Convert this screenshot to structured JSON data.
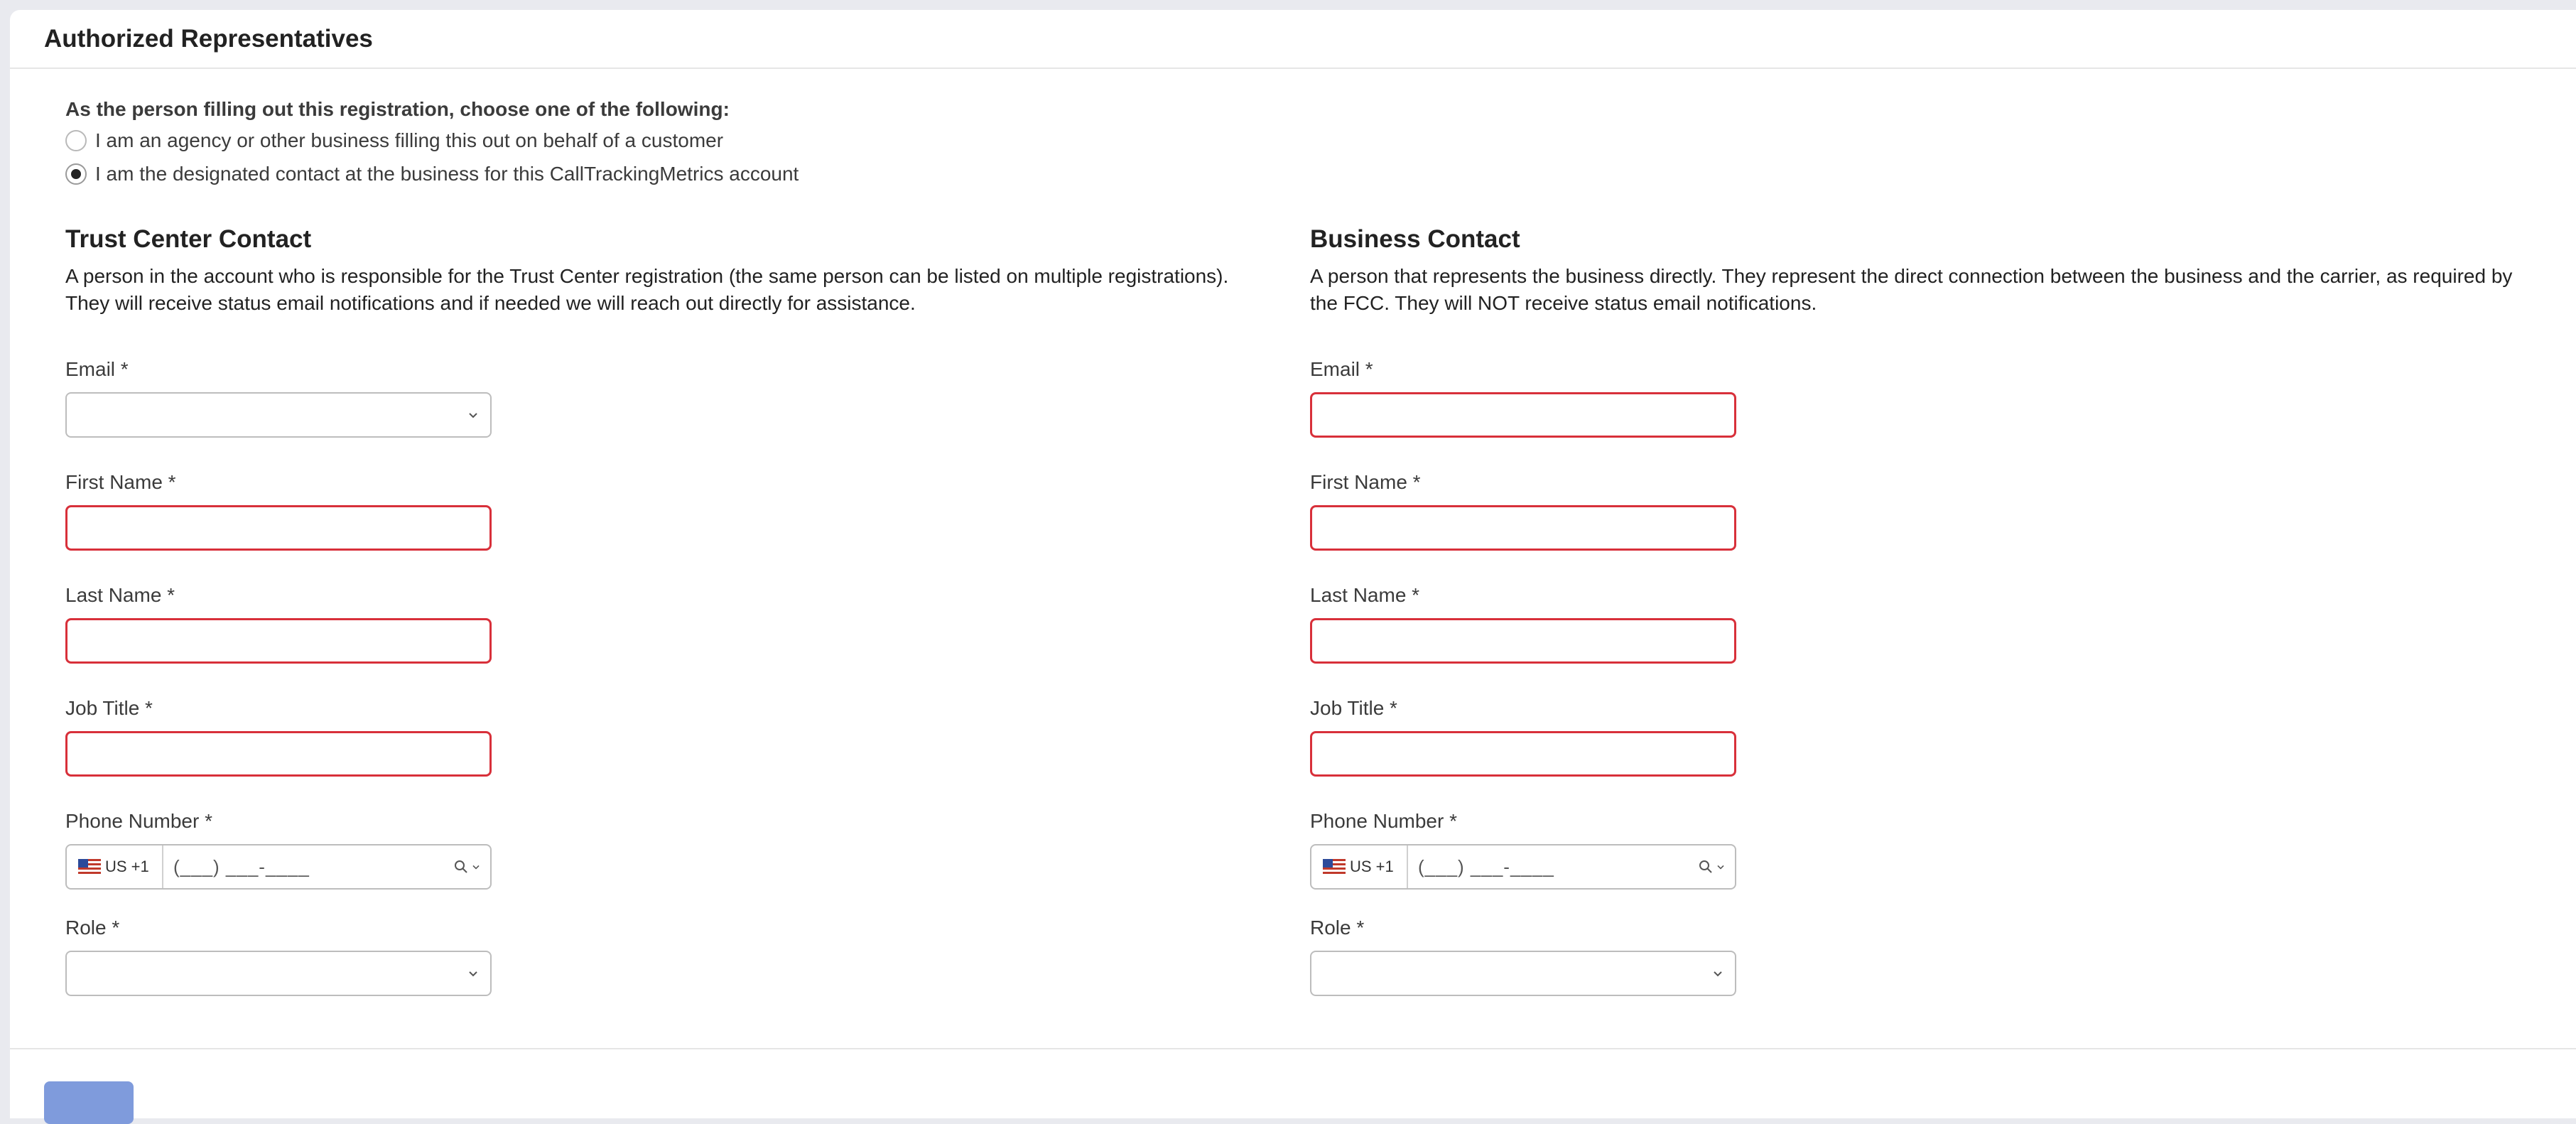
{
  "section": {
    "title": "Authorized Representatives"
  },
  "filler": {
    "question": "As the person filling out this registration, choose one of the following:",
    "options": [
      {
        "label": "I am an agency or other business filling this out on behalf of a customer",
        "selected": false
      },
      {
        "label": "I am the designated contact at the business for this CallTrackingMetrics account",
        "selected": true
      }
    ]
  },
  "trust_contact": {
    "title": "Trust Center Contact",
    "description": "A person in the account who is responsible for the Trust Center registration (the same person can be listed on multiple registrations). They will receive status email notifications and if needed we will reach out directly for assistance.",
    "email_label": "Email *",
    "email_value": "",
    "first_name_label": "First Name *",
    "first_name_value": "",
    "last_name_label": "Last Name *",
    "last_name_value": "",
    "job_title_label": "Job Title *",
    "job_title_value": "",
    "phone_label": "Phone Number *",
    "phone_country": "US +1",
    "phone_mask": "(___) ___-____",
    "role_label": "Role *",
    "role_value": ""
  },
  "business_contact": {
    "title": "Business Contact",
    "description": "A person that represents the business directly. They represent the direct connection between the business and the carrier, as required by the FCC. They will NOT receive status email notifications.",
    "email_label": "Email *",
    "email_value": "",
    "first_name_label": "First Name *",
    "first_name_value": "",
    "last_name_label": "Last Name *",
    "last_name_value": "",
    "job_title_label": "Job Title *",
    "job_title_value": "",
    "phone_label": "Phone Number *",
    "phone_country": "US +1",
    "phone_mask": "(___) ___-____",
    "role_label": "Role *",
    "role_value": ""
  },
  "colors": {
    "error_border": "#d8303a",
    "primary_button": "#7f9bdc",
    "page_background": "#e9eaef"
  },
  "icons": {
    "chevron": "chevron-down-icon",
    "search": "search-icon",
    "flag": "us-flag-icon"
  }
}
